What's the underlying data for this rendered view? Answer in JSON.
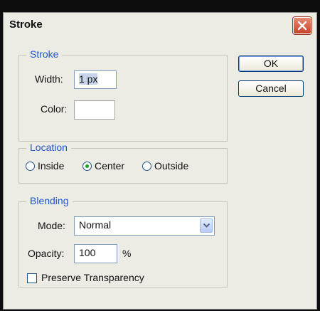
{
  "dialog": {
    "title": "Stroke",
    "ok_label": "OK",
    "cancel_label": "Cancel"
  },
  "stroke": {
    "legend": "Stroke",
    "width_label": "Width:",
    "width_value": "1 px",
    "color_label": "Color:",
    "color_value": "#ffffff"
  },
  "location": {
    "legend": "Location",
    "options": [
      "Inside",
      "Center",
      "Outside"
    ],
    "selected": "Center"
  },
  "blending": {
    "legend": "Blending",
    "mode_label": "Mode:",
    "mode_value": "Normal",
    "opacity_label": "Opacity:",
    "opacity_value": "100",
    "opacity_unit": "%",
    "preserve_label": "Preserve Transparency",
    "preserve_checked": false
  },
  "icons": {
    "close": "close-icon",
    "dropdown": "chevron-down-icon"
  },
  "colors": {
    "legend_text": "#1f56cc",
    "close_button": "#c7422a",
    "dialog_bg": "#ecebe4"
  }
}
